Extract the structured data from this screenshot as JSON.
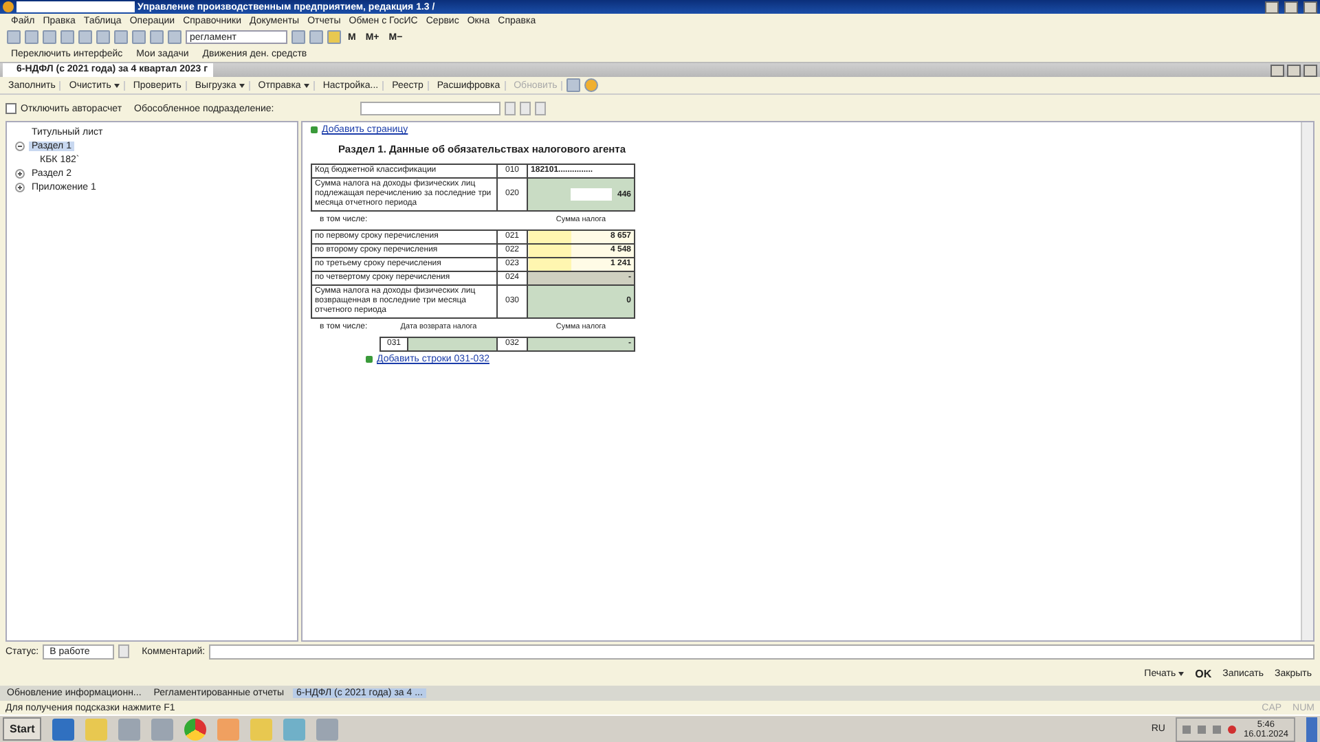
{
  "window": {
    "title": "Управление производственным предприятием, редакция 1.3 /"
  },
  "menu": [
    "Файл",
    "Правка",
    "Таблица",
    "Операции",
    "Справочники",
    "Документы",
    "Отчеты",
    "Обмен с ГосИС",
    "Сервис",
    "Окна",
    "Справка"
  ],
  "toolbar": {
    "search_value": "регламент",
    "memory_buttons": [
      "M",
      "M+",
      "M−"
    ]
  },
  "quick_bar": [
    "Переключить интерфейс",
    "Мои задачи",
    "Движения ден. средств"
  ],
  "form": {
    "title": "6-НДФЛ (с 2021 года) за 4 квартал 2023 г",
    "actions": [
      {
        "label": "Заполнить",
        "dropdown": false,
        "disabled": false
      },
      {
        "label": "Очистить",
        "dropdown": true,
        "disabled": false
      },
      {
        "label": "Проверить",
        "dropdown": false,
        "disabled": false
      },
      {
        "label": "Выгрузка",
        "dropdown": true,
        "disabled": false
      },
      {
        "label": "Отправка",
        "dropdown": true,
        "disabled": false
      },
      {
        "label": "Настройка...",
        "dropdown": false,
        "disabled": false
      },
      {
        "label": "Реестр",
        "dropdown": false,
        "disabled": false
      },
      {
        "label": "Расшифровка",
        "dropdown": false,
        "disabled": false
      },
      {
        "label": "Обновить",
        "dropdown": false,
        "disabled": true
      }
    ],
    "autocalc": {
      "label": "Отключить авторасчет",
      "checked": false
    },
    "subdivision": {
      "label": "Обособленное подразделение:"
    },
    "tree": [
      {
        "label": "Титульный лист",
        "selected": false
      },
      {
        "label": "Раздел 1",
        "selected": true,
        "expanded": true,
        "children": [
          {
            "label": "КБК 182`",
            "selected": false
          }
        ]
      },
      {
        "label": "Раздел 2",
        "selected": false,
        "expanded": false
      },
      {
        "label": "Приложение 1",
        "selected": false,
        "expanded": false
      }
    ],
    "report": {
      "add_page": "Добавить страницу",
      "heading": "Раздел 1. Данные об обязательствах налогового агента",
      "rows": [
        {
          "kind": "plain",
          "label": "Код бюджетной классификации",
          "code": "010",
          "value": "182101..............."
        },
        {
          "kind": "computed",
          "label": "Сумма налога на доходы физических лиц подлежащая перечислению за последние три месяца отчетного периода",
          "code": "020",
          "value": "446"
        },
        {
          "kind": "subheader",
          "label": "в том числе:",
          "value_heading": "Сумма налога"
        },
        {
          "kind": "entered",
          "label": "по первому сроку перечисления",
          "code": "021",
          "value": "8 657"
        },
        {
          "kind": "entered",
          "label": "по второму сроку перечисления",
          "code": "022",
          "value": "4 548"
        },
        {
          "kind": "entered",
          "label": "по третьему сроку перечисления",
          "code": "023",
          "value": "1 241"
        },
        {
          "kind": "inactive",
          "label": "по четвертому сроку перечисления",
          "code": "024",
          "value": "-"
        },
        {
          "kind": "computed",
          "label": "Сумма налога на доходы физических лиц возвращенная в последние три месяца отчетного периода",
          "code": "030",
          "value": "0"
        },
        {
          "kind": "subheader",
          "label": "в том числе:",
          "date_heading": "Дата возврата налога",
          "value_heading": "Сумма налога"
        },
        {
          "kind": "pair",
          "code": "031",
          "code_2": "032",
          "value": "-"
        }
      ],
      "add_rows": "Добавить строки 031-032"
    },
    "status": {
      "label": "Статус:",
      "value": "В работе",
      "comment_label": "Комментарий:"
    },
    "buttons": [
      {
        "label": "Печать",
        "kind": "menu"
      },
      {
        "label": "OK",
        "kind": "default"
      },
      {
        "label": "Записать",
        "kind": "plain"
      },
      {
        "label": "Закрыть",
        "kind": "plain"
      }
    ]
  },
  "open_windows": [
    {
      "label": "Обновление информационн...",
      "selected": false
    },
    {
      "label": "Регламентированные отчеты",
      "selected": false
    },
    {
      "label": "6-НДФЛ (с 2021 года) за 4 ...",
      "selected": true
    }
  ],
  "status_bar": {
    "hint": "Для получения подсказки нажмите F1",
    "indicators": [
      "CAP",
      "NUM"
    ]
  },
  "taskbar": {
    "start": "Start",
    "language": "RU",
    "time": "5:46",
    "date": "16.01.2024"
  }
}
